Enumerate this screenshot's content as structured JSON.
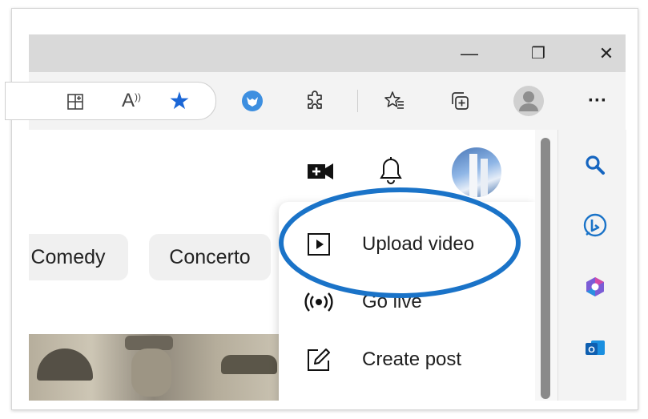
{
  "window": {
    "minimize_glyph": "—",
    "restore_glyph": "❐",
    "close_glyph": "✕"
  },
  "toolbar": {
    "read_aloud_glyph": "A",
    "favorite_glyph": "★",
    "more_glyph": "···"
  },
  "chips": [
    {
      "label": "Comedy"
    },
    {
      "label": "Concerto"
    }
  ],
  "create_menu": {
    "items": [
      {
        "label": "Upload video",
        "icon": "play-square-icon"
      },
      {
        "label": "Go live",
        "icon": "broadcast-icon"
      },
      {
        "label": "Create post",
        "icon": "edit-square-icon"
      }
    ]
  },
  "colors": {
    "highlight_ellipse": "#1a73c8",
    "favorite_star": "#1a66d6",
    "search_icon": "#1565c0"
  }
}
